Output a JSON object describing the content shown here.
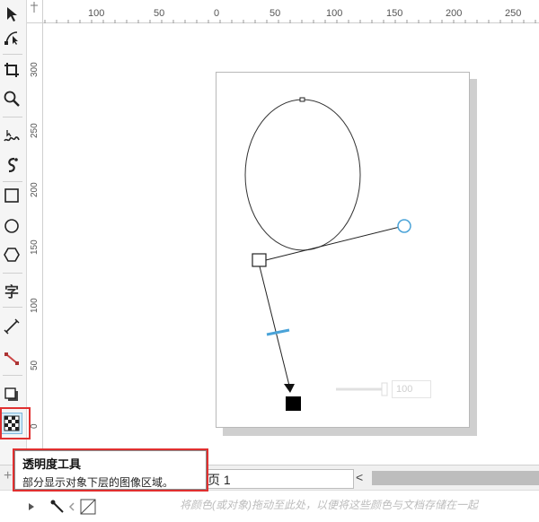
{
  "ruler": {
    "top_labels": [
      "100",
      "50",
      "0",
      "50",
      "100",
      "150",
      "200",
      "250"
    ],
    "left_labels": [
      "300",
      "250",
      "200",
      "150",
      "100",
      "50",
      "0"
    ]
  },
  "toolbox": {
    "items": [
      {
        "name": "pick-tool",
        "icon": "arrow-pointer-icon"
      },
      {
        "name": "shape-tool",
        "icon": "node-edit-icon"
      },
      {
        "name": "crop-tool",
        "icon": "crop-icon"
      },
      {
        "name": "zoom-tool",
        "icon": "magnifier-icon"
      },
      {
        "name": "freehand-tool",
        "icon": "freehand-icon"
      },
      {
        "name": "artistic-media-tool",
        "icon": "brush-curve-icon"
      },
      {
        "name": "rectangle-tool",
        "icon": "rectangle-icon"
      },
      {
        "name": "ellipse-tool",
        "icon": "ellipse-icon"
      },
      {
        "name": "polygon-tool",
        "icon": "polygon-icon"
      },
      {
        "name": "text-tool",
        "icon": "text-icon",
        "label": "字"
      },
      {
        "name": "parallel-dimension-tool",
        "icon": "dimension-line-icon"
      },
      {
        "name": "connector-tool",
        "icon": "connector-icon"
      },
      {
        "name": "drop-shadow-tool",
        "icon": "drop-shadow-icon"
      },
      {
        "name": "transparency-tool",
        "icon": "transparency-checker-icon"
      }
    ]
  },
  "canvas": {
    "transparency_slider_value": "100"
  },
  "pagebar": {
    "add_icon": "+",
    "page_tab_label": "页 1",
    "scroll_left": "<"
  },
  "statusbar": {
    "hint": "将颜色(或对象)拖动至此处，以便将这些颜色与文档存储在一起"
  },
  "tooltip": {
    "title": "透明度工具",
    "description": "部分显示对象下层的图像区域。"
  },
  "colors": {
    "highlight": "#e03030",
    "handle_accent": "#4aa3d8",
    "toolbox_bg": "#f5f5f5"
  }
}
